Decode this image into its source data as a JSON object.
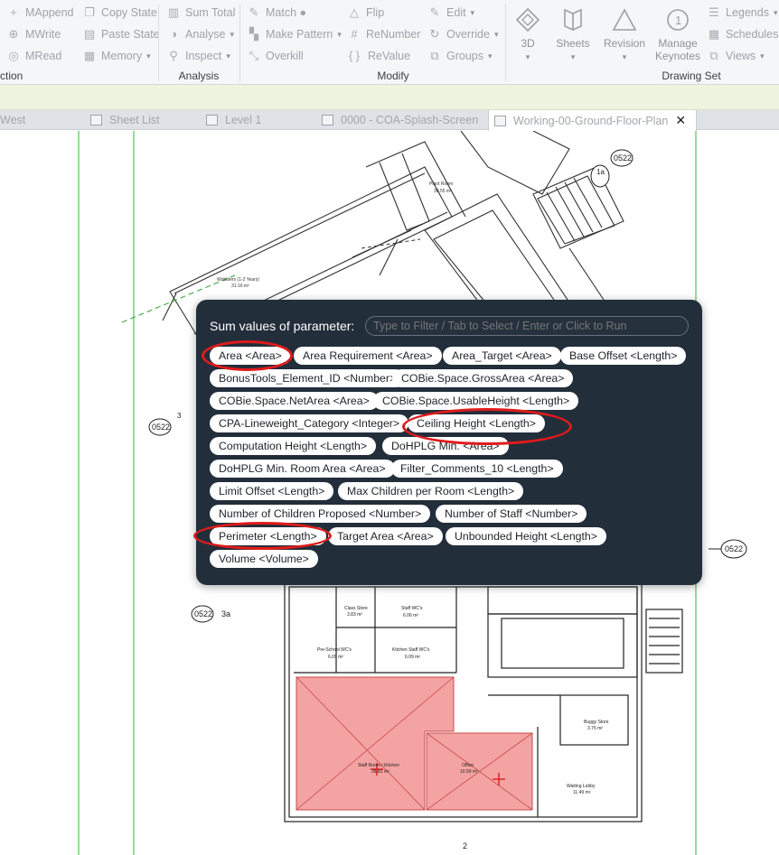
{
  "ribbon": {
    "col1": [
      "MAppend",
      "MWrite",
      "MRead"
    ],
    "col2": [
      "Copy State",
      "Paste State",
      "Memory"
    ],
    "col3": [
      "Sum Total",
      "Analyse",
      "Inspect"
    ],
    "col4": [
      "Match ●",
      "Make Pattern",
      "Overkill"
    ],
    "col5": [
      "Flip",
      "ReNumber",
      "ReValue"
    ],
    "col6": [
      "Edit",
      "Override",
      "Groups"
    ],
    "big": {
      "d3": "3D",
      "sheets": "Sheets",
      "revision": "Revision",
      "manage_keynotes_1": "Manage",
      "manage_keynotes_2": "Keynotes"
    },
    "col7": [
      "Legends",
      "Schedules",
      "Views"
    ],
    "groups": {
      "left": "ction",
      "analysis": "Analysis",
      "modify": "Modify",
      "drawing_set": "Drawing Set"
    }
  },
  "tabs": [
    "West",
    "Sheet List",
    "Level 1",
    "0000 - COA-Splash-Screen",
    "Working-00-Ground-Floor-Plan"
  ],
  "tab_close": "✕",
  "popup": {
    "title": "Sum values of parameter:",
    "placeholder": "Type to Filter / Tab to Select / Enter or Click to Run",
    "chips": [
      "Area <Area>",
      "Area Requirement <Area>",
      "Area_Target <Area>",
      "Base Offset <Length>",
      "BonusTools_Element_ID <Number>",
      "COBie.Space.GrossArea <Area>",
      "COBie.Space.NetArea <Area>",
      "COBie.Space.UsableHeight <Length>",
      "CPA-Lineweight_Category <Integer>",
      "Ceiling Height <Length>",
      "Computation Height <Length>",
      "DoHPLG Min. <Area>",
      "DoHPLG Min. Room Area <Area>",
      "Filter_Comments_10 <Length>",
      "Limit Offset <Length>",
      "Max Children per Room <Length>",
      "Number of Children Proposed <Number>",
      "Number of Staff <Number>",
      "Perimeter <Length>",
      "Target Area <Area>",
      "Unbounded Height <Length>",
      "Volume <Volume>"
    ]
  },
  "plan": {
    "rooms": {
      "plant_room": "Plant Room",
      "plant_area": "30.55 m²",
      "wobblers": "Wobblers (1-2 Years)",
      "wobblers_area": "31.16 m²",
      "class_store": "Class Store",
      "class_store_area": "3.83 m²",
      "staff_wcs": "Staff WC's",
      "staff_wcs_area": "6.06 m²",
      "preschool_wcs": "Pre-School WC's",
      "preschool_wcs_area": "6.09 m²",
      "kitchen_wcs": "Kitchen Staff WC's",
      "kitchen_wcs_area": "6.09 m²",
      "staff_room": "Staff Room / Kitchen",
      "staff_room_area": "28.81 m²",
      "office": "Office",
      "office_area": "10.59 m²",
      "buggy": "Buggy Store",
      "buggy_area": "3.75 m²",
      "waiting": "Waiting Lobby",
      "waiting_area": "11.49 m²"
    },
    "tags": [
      "0522",
      "1a",
      "0522",
      "3",
      "0522",
      "3a",
      "0522"
    ],
    "grid_bottom": "2"
  },
  "colors": {
    "highlight_room": "#f4a3a3",
    "ring": "#e01b1b",
    "popup_bg": "#232e3b",
    "grid_line": "#35b335"
  }
}
